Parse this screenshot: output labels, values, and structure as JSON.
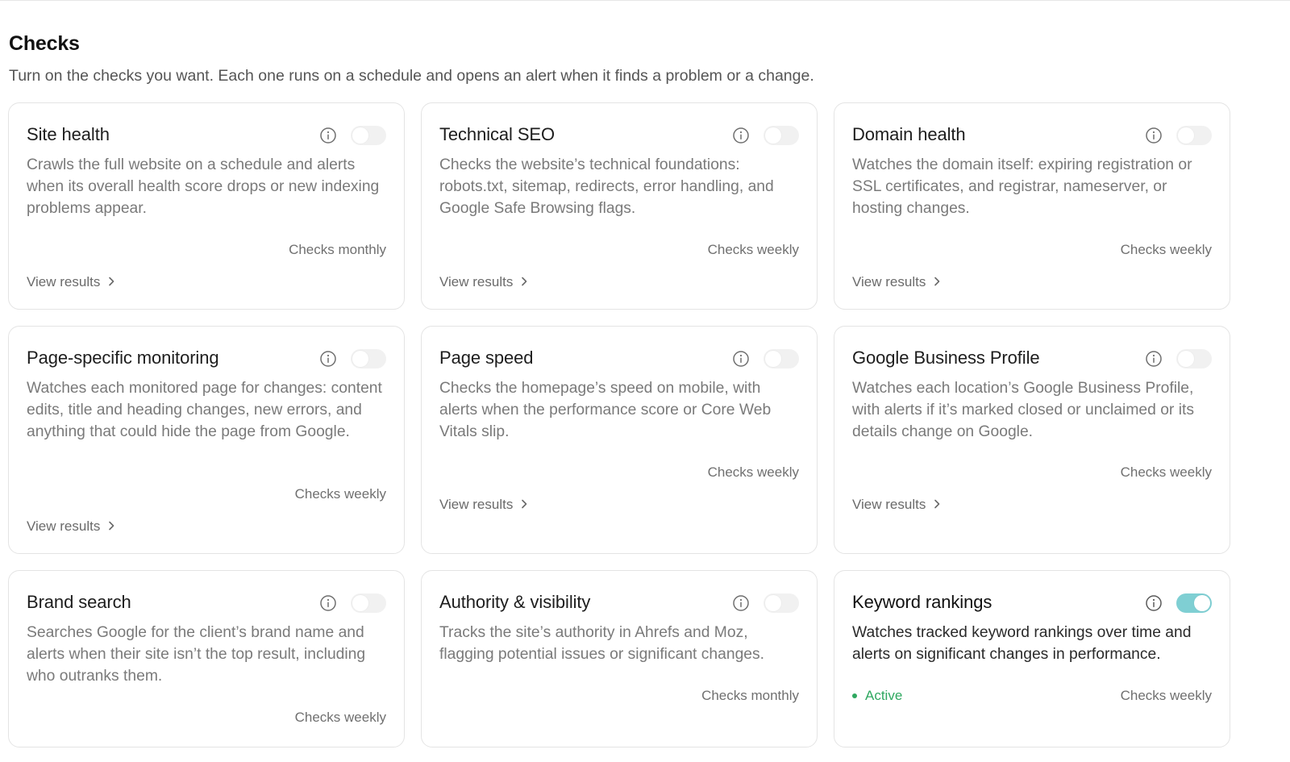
{
  "header": {
    "title": "Checks",
    "subtitle": "Turn on the checks you want. Each one runs on a schedule and opens an alert when it finds a problem or a change."
  },
  "view_results_label": "View results",
  "colors": {
    "toggle_on": "#7fcfd3",
    "toggle_off": "#f1f1f1",
    "active_status": "#2fa860"
  },
  "cards": [
    {
      "title": "Site health",
      "description": "Crawls the full website on a schedule and alerts when its overall health score drops or new indexing problems appear.",
      "frequency": "Checks monthly",
      "enabled": false,
      "link": "View results"
    },
    {
      "title": "Technical SEO",
      "description": "Checks the website’s technical foundations: robots.txt, sitemap, redirects, error handling, and Google Safe Browsing flags.",
      "frequency": "Checks weekly",
      "enabled": false,
      "link": "View results"
    },
    {
      "title": "Domain health",
      "description": "Watches the domain itself: expiring registration or SSL certificates, and registrar, nameserver, or hosting changes.",
      "frequency": "Checks weekly",
      "enabled": false,
      "link": "View results"
    },
    {
      "title": "Page-specific monitoring",
      "description": "Watches each monitored page for changes: content edits, title and heading changes, new errors, and anything that could hide the page from Google.",
      "frequency": "Checks weekly",
      "enabled": false,
      "link": "View results"
    },
    {
      "title": "Page speed",
      "description": "Checks the homepage’s speed on mobile, with alerts when the performance score or Core Web Vitals slip.",
      "frequency": "Checks weekly",
      "enabled": false,
      "link": "View results"
    },
    {
      "title": "Google Business Profile",
      "description": "Watches each location’s Google Business Profile, with alerts if it’s marked closed or unclaimed or its details change on Google.",
      "frequency": "Checks weekly",
      "enabled": false,
      "link": "View results"
    },
    {
      "title": "Brand search",
      "description": "Searches Google for the client’s brand name and alerts when their site isn’t the top result, including who outranks them.",
      "frequency": "Checks weekly",
      "enabled": false
    },
    {
      "title": "Authority & visibility",
      "description": "Tracks the site’s authority in Ahrefs and Moz, flagging potential issues or significant changes.",
      "frequency": "Checks monthly",
      "enabled": false
    },
    {
      "title": "Keyword rankings",
      "description": "Watches tracked keyword rankings over time and alerts on significant changes in performance.",
      "frequency": "Checks weekly",
      "enabled": true,
      "status": "Active"
    }
  ]
}
